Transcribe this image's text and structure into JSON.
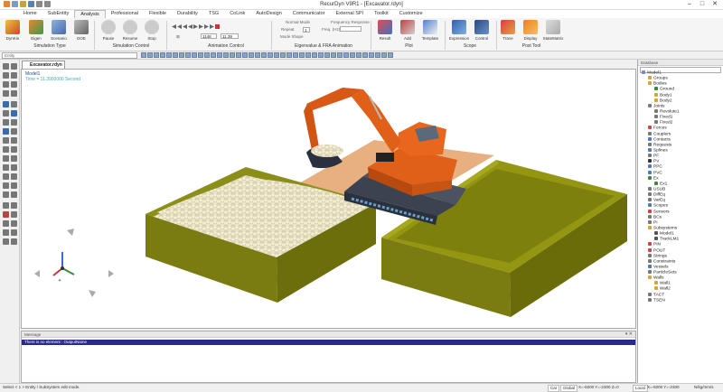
{
  "window": {
    "title": "RecurDyn V9R1 - [Excavator.rdyn]"
  },
  "menu_tabs": [
    "Home",
    "SubEntity",
    "Analysis",
    "Professional",
    "Flexible",
    "Durability",
    "TSG",
    "CoLink",
    "AutoDesign",
    "Communicator",
    "External SPI",
    "Toolkit",
    "Customize"
  ],
  "active_tab": "Analysis",
  "ribbon": {
    "dynkin": "DynKin",
    "eigen": "Eigen",
    "scenario": "Scenario",
    "doe": "DOE",
    "group_simulation_type": "Simulation Type",
    "pause": "Pause",
    "resume": "Resume",
    "stop": "Stop",
    "group_simulation_control": "Simulation Control",
    "frame_value": "1148",
    "frame_total": "11.39",
    "repeat_label": "Repeat",
    "repeat_value": "1",
    "group_animation_control": "Animation Control",
    "normal_mode": "Normal Mode",
    "mode_shape": "Mode Shape",
    "freq_response": "Frequency Response",
    "freq_hz": "Freq. (Hz)",
    "group_eigenvalue": "Eigenvalue & FRA Animation",
    "result": "Result",
    "add": "Add",
    "template": "Template",
    "group_plot": "Plot",
    "expression": "Expression",
    "control": "Control",
    "group_scope": "Scope",
    "trace": "Trace",
    "display": "Display",
    "statematrix": "StateMatrix",
    "group_post_tool": "Post Tool"
  },
  "toolbar": {
    "entity_placeholder": "Entity"
  },
  "doc_tab": "Excavator.rdyn",
  "viewport": {
    "model_label": "Model1",
    "time_label": "Time = 11.3900000 Second"
  },
  "message": {
    "header": "Message",
    "line": "There is no element : OutputName"
  },
  "database": {
    "header": "Database",
    "tree": [
      {
        "label": "Model1",
        "depth": 0,
        "color": "#6b8fc4"
      },
      {
        "label": "Groups",
        "depth": 1,
        "color": "#d9a33a"
      },
      {
        "label": "Bodies",
        "depth": 1,
        "color": "#d9a33a"
      },
      {
        "label": "Ground",
        "depth": 2,
        "color": "#3a8a3a"
      },
      {
        "label": "Body1",
        "depth": 2,
        "color": "#d9a33a"
      },
      {
        "label": "Body2",
        "depth": 2,
        "color": "#d9a33a"
      },
      {
        "label": "Joints",
        "depth": 1,
        "color": "#7a7a7a"
      },
      {
        "label": "Revolute1",
        "depth": 2,
        "color": "#7a7a7a"
      },
      {
        "label": "Fixed1",
        "depth": 2,
        "color": "#7a7a7a"
      },
      {
        "label": "Fixed2",
        "depth": 2,
        "color": "#7a7a7a"
      },
      {
        "label": "Forces",
        "depth": 1,
        "color": "#c44"
      },
      {
        "label": "Couplers",
        "depth": 1,
        "color": "#777"
      },
      {
        "label": "Contacts",
        "depth": 1,
        "color": "#4a7ac4"
      },
      {
        "label": "Requests",
        "depth": 1,
        "color": "#777"
      },
      {
        "label": "Splines",
        "depth": 1,
        "color": "#4a7ac4"
      },
      {
        "label": "PF",
        "depth": 1,
        "color": "#777"
      },
      {
        "label": "PV",
        "depth": 1,
        "color": "#333"
      },
      {
        "label": "PPC",
        "depth": 1,
        "color": "#4a7ac4"
      },
      {
        "label": "PVC",
        "depth": 1,
        "color": "#4a7ac4"
      },
      {
        "label": "Ex",
        "depth": 1,
        "color": "#3a8a3a"
      },
      {
        "label": "Ex1",
        "depth": 2,
        "color": "#3a8a3a"
      },
      {
        "label": "USUB",
        "depth": 1,
        "color": "#777"
      },
      {
        "label": "DiffEq",
        "depth": 1,
        "color": "#777"
      },
      {
        "label": "VarEq",
        "depth": 1,
        "color": "#777"
      },
      {
        "label": "Scopes",
        "depth": 1,
        "color": "#4a7ac4"
      },
      {
        "label": "Sensors",
        "depth": 1,
        "color": "#c44"
      },
      {
        "label": "BCs",
        "depth": 1,
        "color": "#777"
      },
      {
        "label": "PI",
        "depth": 1,
        "color": "#777"
      },
      {
        "label": "Subsystems",
        "depth": 1,
        "color": "#d9a33a"
      },
      {
        "label": "Model1",
        "depth": 2,
        "color": "#555"
      },
      {
        "label": "TrackLM1",
        "depth": 2,
        "color": "#555"
      },
      {
        "label": "PIN",
        "depth": 1,
        "color": "#c44"
      },
      {
        "label": "POUT",
        "depth": 1,
        "color": "#c44"
      },
      {
        "label": "Strings",
        "depth": 1,
        "color": "#777"
      },
      {
        "label": "Constraints",
        "depth": 1,
        "color": "#777"
      },
      {
        "label": "Vessels",
        "depth": 1,
        "color": "#4a7ac4"
      },
      {
        "label": "ParticleSets",
        "depth": 1,
        "color": "#777"
      },
      {
        "label": "Walls",
        "depth": 1,
        "color": "#d9a33a"
      },
      {
        "label": "Wall1",
        "depth": 2,
        "color": "#d9a33a"
      },
      {
        "label": "Wall2",
        "depth": 2,
        "color": "#d9a33a"
      },
      {
        "label": "TACT",
        "depth": 1,
        "color": "#777"
      },
      {
        "label": "TSEN",
        "depth": 1,
        "color": "#777"
      }
    ]
  },
  "status": {
    "hint": "Select < 1 > Entity / SubSystem edit mode.",
    "car": "Car",
    "global": "Global",
    "coords1": "X=-8200 Y=-2300 Z=0",
    "local": "Local",
    "coords2": "X=-8200 Y=-2300",
    "units": "N/kg/mm/s"
  },
  "colors": {
    "body_orange": "#e8661e",
    "box_olive": "#7c7c10",
    "pebble": "#e8e2c2",
    "highlight": "#2b2b85"
  }
}
